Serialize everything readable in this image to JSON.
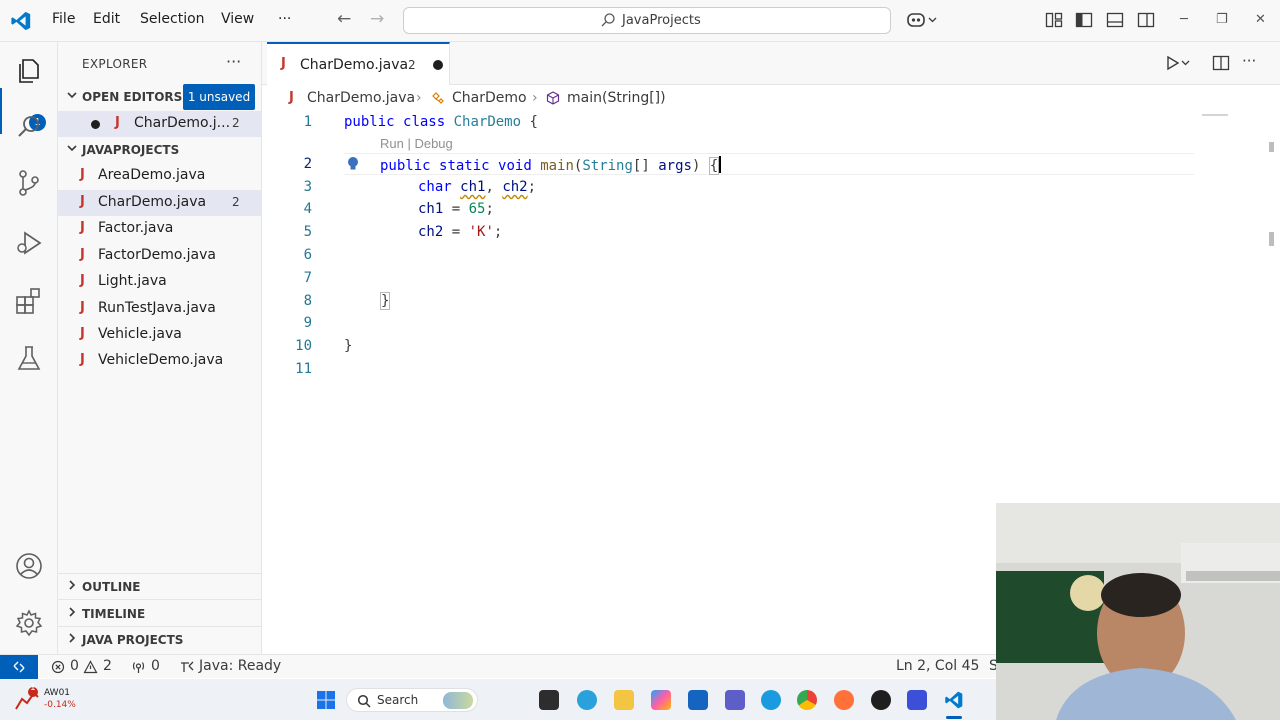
{
  "titlebar": {
    "menus": [
      "File",
      "Edit",
      "Selection",
      "View",
      "···"
    ],
    "search_text": "JavaProjects"
  },
  "activitybar": {
    "explorer_badge": "1"
  },
  "sidebar": {
    "title": "EXPLORER",
    "more": "···",
    "open_editors": {
      "label": "OPEN EDITORS",
      "badge": "1 unsaved",
      "items": [
        {
          "name": "CharDemo.j...",
          "count": "2"
        }
      ]
    },
    "project": {
      "label": "JAVAPROJECTS",
      "files": [
        {
          "name": "AreaDemo.java",
          "count": ""
        },
        {
          "name": "CharDemo.java",
          "count": "2"
        },
        {
          "name": "Factor.java",
          "count": ""
        },
        {
          "name": "FactorDemo.java",
          "count": ""
        },
        {
          "name": "Light.java",
          "count": ""
        },
        {
          "name": "RunTestJava.java",
          "count": ""
        },
        {
          "name": "Vehicle.java",
          "count": ""
        },
        {
          "name": "VehicleDemo.java",
          "count": ""
        }
      ]
    },
    "outline_label": "OUTLINE",
    "timeline_label": "TIMELINE",
    "java_projects_label": "JAVA PROJECTS"
  },
  "editor": {
    "tab": {
      "name": "CharDemo.java",
      "count": "2",
      "icon_letter": "J"
    },
    "breadcrumb": {
      "file": "CharDemo.java",
      "class": "CharDemo",
      "method": "main(String[])"
    },
    "codelens": "Run | Debug",
    "line_numbers": [
      "1",
      "2",
      "3",
      "4",
      "5",
      "6",
      "7",
      "8",
      "9",
      "10",
      "11"
    ]
  },
  "statusbar": {
    "errors": "0",
    "warnings": "2",
    "ports": "0",
    "java_status": "Java: Ready",
    "position": "Ln 2, Col 45",
    "trailing": "S"
  },
  "taskbar": {
    "stock_name": "AW01",
    "stock_change": "-0.14%",
    "stock_alert": "1",
    "search_label": "Search"
  },
  "colors": {
    "accent": "#005fb8",
    "java_icon": "#c5362f",
    "keyword": "#0000ff",
    "type": "#267f99",
    "number": "#098658",
    "string": "#a31515"
  }
}
